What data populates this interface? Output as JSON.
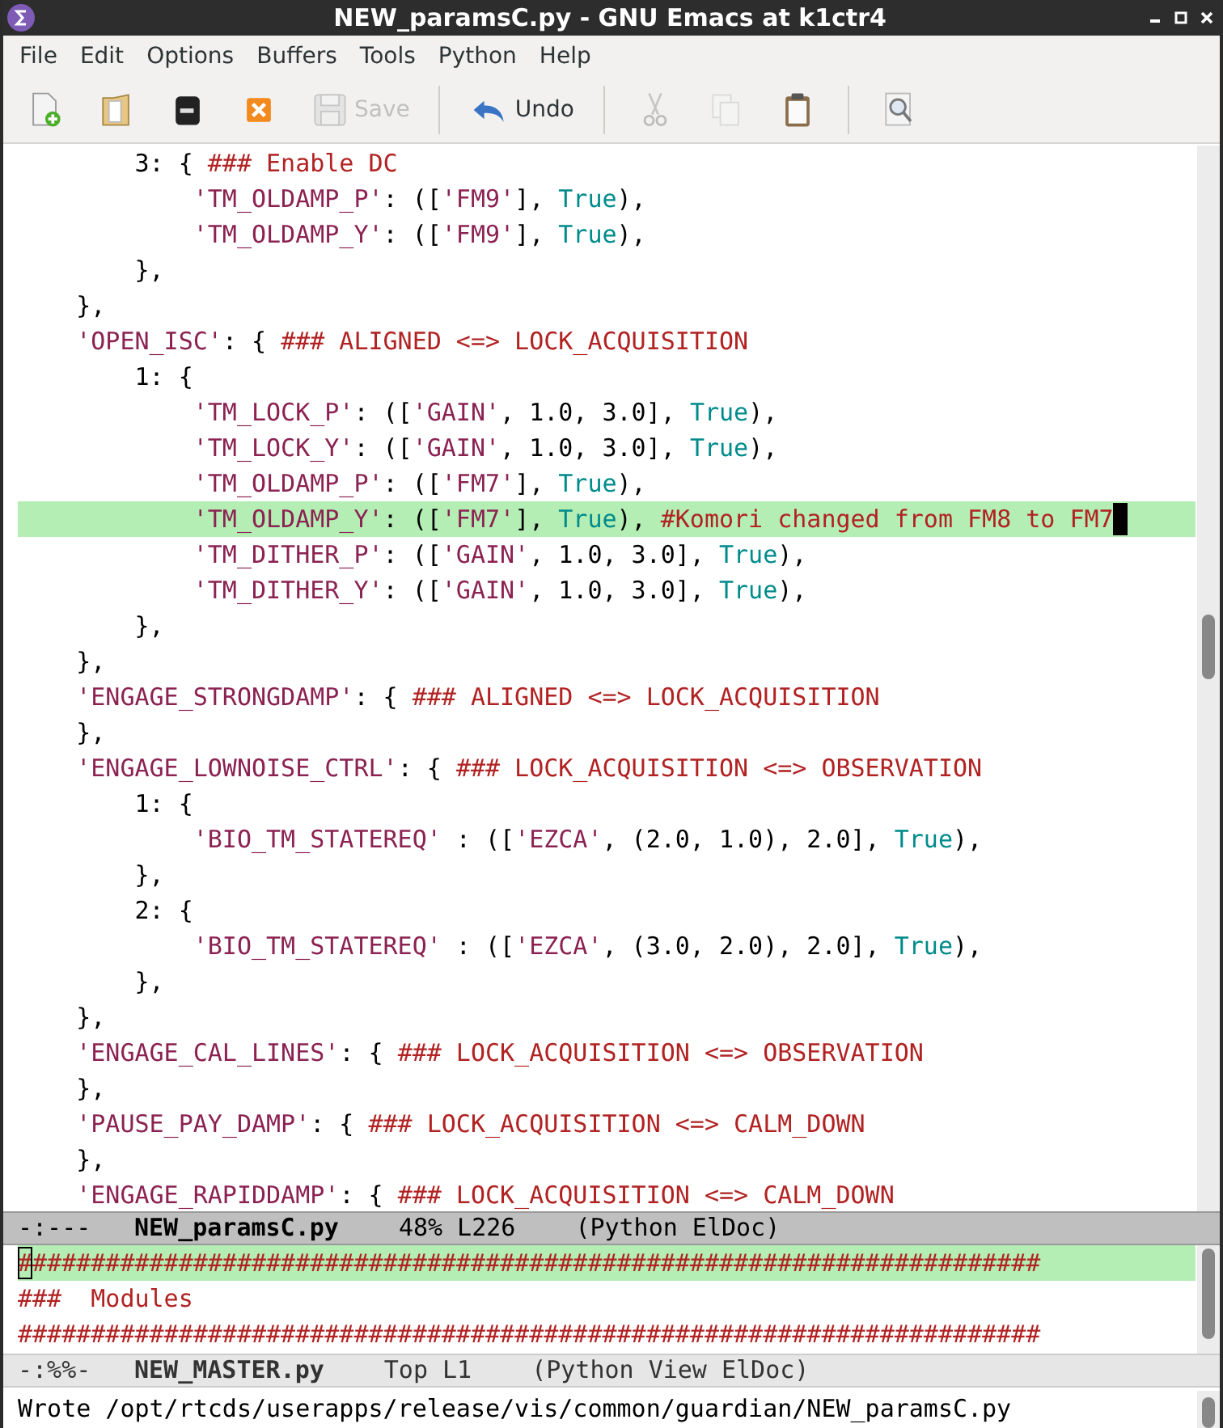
{
  "window": {
    "title": "NEW_paramsC.py - GNU Emacs at k1ctr4"
  },
  "menu_bar": [
    "File",
    "Edit",
    "Options",
    "Buffers",
    "Tools",
    "Python",
    "Help"
  ],
  "toolbar": [
    {
      "kind": "new-file",
      "disabled": false
    },
    {
      "kind": "open-folder",
      "disabled": false
    },
    {
      "kind": "close-buffer",
      "disabled": false
    },
    {
      "kind": "cancel",
      "disabled": false
    },
    {
      "kind": "save",
      "label": "Save",
      "disabled": true
    },
    {
      "kind": "separator"
    },
    {
      "kind": "undo",
      "label": "Undo",
      "disabled": false
    },
    {
      "kind": "separator"
    },
    {
      "kind": "cut",
      "disabled": true
    },
    {
      "kind": "copy",
      "disabled": true
    },
    {
      "kind": "paste",
      "disabled": false
    },
    {
      "kind": "separator"
    },
    {
      "kind": "search",
      "disabled": false
    }
  ],
  "panes": [
    {
      "active": true,
      "lines": [
        {
          "current": false,
          "tokens": [
            {
              "kind": "plain",
              "text": "        3: { "
            },
            {
              "kind": "comment",
              "text": "### Enable DC"
            }
          ]
        },
        {
          "current": false,
          "tokens": [
            {
              "kind": "string",
              "text": "            'TM_OLDAMP_P'"
            },
            {
              "kind": "plain",
              "text": ": (["
            },
            {
              "kind": "string",
              "text": "'FM9'"
            },
            {
              "kind": "plain",
              "text": "], "
            },
            {
              "kind": "builtin",
              "text": "True"
            },
            {
              "kind": "plain",
              "text": "),"
            }
          ]
        },
        {
          "current": false,
          "tokens": [
            {
              "kind": "string",
              "text": "            'TM_OLDAMP_Y'"
            },
            {
              "kind": "plain",
              "text": ": (["
            },
            {
              "kind": "string",
              "text": "'FM9'"
            },
            {
              "kind": "plain",
              "text": "], "
            },
            {
              "kind": "builtin",
              "text": "True"
            },
            {
              "kind": "plain",
              "text": "),"
            }
          ]
        },
        {
          "current": false,
          "tokens": [
            {
              "kind": "plain",
              "text": "        },"
            }
          ]
        },
        {
          "current": false,
          "tokens": [
            {
              "kind": "plain",
              "text": "    },"
            }
          ]
        },
        {
          "current": false,
          "tokens": [
            {
              "kind": "string",
              "text": "    'OPEN_ISC'"
            },
            {
              "kind": "plain",
              "text": ": { "
            },
            {
              "kind": "comment",
              "text": "### ALIGNED <=> LOCK_ACQUISITION"
            }
          ]
        },
        {
          "current": false,
          "tokens": [
            {
              "kind": "plain",
              "text": "        1: {"
            }
          ]
        },
        {
          "current": false,
          "tokens": [
            {
              "kind": "string",
              "text": "            'TM_LOCK_P'"
            },
            {
              "kind": "plain",
              "text": ": (["
            },
            {
              "kind": "string",
              "text": "'GAIN'"
            },
            {
              "kind": "plain",
              "text": ", 1.0, 3.0], "
            },
            {
              "kind": "builtin",
              "text": "True"
            },
            {
              "kind": "plain",
              "text": "),"
            }
          ]
        },
        {
          "current": false,
          "tokens": [
            {
              "kind": "string",
              "text": "            'TM_LOCK_Y'"
            },
            {
              "kind": "plain",
              "text": ": (["
            },
            {
              "kind": "string",
              "text": "'GAIN'"
            },
            {
              "kind": "plain",
              "text": ", 1.0, 3.0], "
            },
            {
              "kind": "builtin",
              "text": "True"
            },
            {
              "kind": "plain",
              "text": "),"
            }
          ]
        },
        {
          "current": false,
          "tokens": [
            {
              "kind": "string",
              "text": "            'TM_OLDAMP_P'"
            },
            {
              "kind": "plain",
              "text": ": (["
            },
            {
              "kind": "string",
              "text": "'FM7'"
            },
            {
              "kind": "plain",
              "text": "], "
            },
            {
              "kind": "builtin",
              "text": "True"
            },
            {
              "kind": "plain",
              "text": "),"
            }
          ]
        },
        {
          "current": true,
          "cursor_at_end": true,
          "tokens": [
            {
              "kind": "string",
              "text": "            'TM_OLDAMP_Y'"
            },
            {
              "kind": "plain",
              "text": ": (["
            },
            {
              "kind": "string",
              "text": "'FM7'"
            },
            {
              "kind": "plain",
              "text": "], "
            },
            {
              "kind": "builtin",
              "text": "True"
            },
            {
              "kind": "plain",
              "text": "), "
            },
            {
              "kind": "comment",
              "text": "#Komori changed from FM8 to FM7"
            }
          ]
        },
        {
          "current": false,
          "tokens": [
            {
              "kind": "string",
              "text": "            'TM_DITHER_P'"
            },
            {
              "kind": "plain",
              "text": ": (["
            },
            {
              "kind": "string",
              "text": "'GAIN'"
            },
            {
              "kind": "plain",
              "text": ", 1.0, 3.0], "
            },
            {
              "kind": "builtin",
              "text": "True"
            },
            {
              "kind": "plain",
              "text": "),"
            }
          ]
        },
        {
          "current": false,
          "tokens": [
            {
              "kind": "string",
              "text": "            'TM_DITHER_Y'"
            },
            {
              "kind": "plain",
              "text": ": (["
            },
            {
              "kind": "string",
              "text": "'GAIN'"
            },
            {
              "kind": "plain",
              "text": ", 1.0, 3.0], "
            },
            {
              "kind": "builtin",
              "text": "True"
            },
            {
              "kind": "plain",
              "text": "),"
            }
          ]
        },
        {
          "current": false,
          "tokens": [
            {
              "kind": "plain",
              "text": "        },"
            }
          ]
        },
        {
          "current": false,
          "tokens": [
            {
              "kind": "plain",
              "text": "    },"
            }
          ]
        },
        {
          "current": false,
          "tokens": [
            {
              "kind": "string",
              "text": "    'ENGAGE_STRONGDAMP'"
            },
            {
              "kind": "plain",
              "text": ": { "
            },
            {
              "kind": "comment",
              "text": "### ALIGNED <=> LOCK_ACQUISITION"
            }
          ]
        },
        {
          "current": false,
          "tokens": [
            {
              "kind": "plain",
              "text": "    },"
            }
          ]
        },
        {
          "current": false,
          "tokens": [
            {
              "kind": "string",
              "text": "    'ENGAGE_LOWNOISE_CTRL'"
            },
            {
              "kind": "plain",
              "text": ": { "
            },
            {
              "kind": "comment",
              "text": "### LOCK_ACQUISITION <=> OBSERVATION"
            }
          ]
        },
        {
          "current": false,
          "tokens": [
            {
              "kind": "plain",
              "text": "        1: {"
            }
          ]
        },
        {
          "current": false,
          "tokens": [
            {
              "kind": "string",
              "text": "            'BIO_TM_STATEREQ'"
            },
            {
              "kind": "plain",
              "text": " : (["
            },
            {
              "kind": "string",
              "text": "'EZCA'"
            },
            {
              "kind": "plain",
              "text": ", (2.0, 1.0), 2.0], "
            },
            {
              "kind": "builtin",
              "text": "True"
            },
            {
              "kind": "plain",
              "text": "),"
            }
          ]
        },
        {
          "current": false,
          "tokens": [
            {
              "kind": "plain",
              "text": "        },"
            }
          ]
        },
        {
          "current": false,
          "tokens": [
            {
              "kind": "plain",
              "text": "        2: {"
            }
          ]
        },
        {
          "current": false,
          "tokens": [
            {
              "kind": "string",
              "text": "            'BIO_TM_STATEREQ'"
            },
            {
              "kind": "plain",
              "text": " : (["
            },
            {
              "kind": "string",
              "text": "'EZCA'"
            },
            {
              "kind": "plain",
              "text": ", (3.0, 2.0), 2.0], "
            },
            {
              "kind": "builtin",
              "text": "True"
            },
            {
              "kind": "plain",
              "text": "),"
            }
          ]
        },
        {
          "current": false,
          "tokens": [
            {
              "kind": "plain",
              "text": "        },"
            }
          ]
        },
        {
          "current": false,
          "tokens": [
            {
              "kind": "plain",
              "text": "    },"
            }
          ]
        },
        {
          "current": false,
          "tokens": [
            {
              "kind": "string",
              "text": "    'ENGAGE_CAL_LINES'"
            },
            {
              "kind": "plain",
              "text": ": { "
            },
            {
              "kind": "comment",
              "text": "### LOCK_ACQUISITION <=> OBSERVATION"
            }
          ]
        },
        {
          "current": false,
          "tokens": [
            {
              "kind": "plain",
              "text": "    },"
            }
          ]
        },
        {
          "current": false,
          "tokens": [
            {
              "kind": "string",
              "text": "    'PAUSE_PAY_DAMP'"
            },
            {
              "kind": "plain",
              "text": ": { "
            },
            {
              "kind": "comment",
              "text": "### LOCK_ACQUISITION <=> CALM_DOWN"
            }
          ]
        },
        {
          "current": false,
          "tokens": [
            {
              "kind": "plain",
              "text": "    },"
            }
          ]
        },
        {
          "current": false,
          "tokens": [
            {
              "kind": "string",
              "text": "    'ENGAGE_RAPIDDAMP'"
            },
            {
              "kind": "plain",
              "text": ": { "
            },
            {
              "kind": "comment",
              "text": "### LOCK_ACQUISITION <=> CALM_DOWN"
            }
          ]
        }
      ],
      "mode_line": {
        "status": "-:---",
        "buffer": "NEW_paramsC.py",
        "position": "48% L226",
        "mode": "(Python ElDoc)"
      }
    },
    {
      "active": false,
      "lines": [
        {
          "current": true,
          "cursor_at_end": false,
          "tokens": [
            {
              "kind": "comment",
              "text": "######################################################################"
            }
          ]
        },
        {
          "current": false,
          "tokens": [
            {
              "kind": "comment",
              "text": "###  Modules"
            }
          ]
        },
        {
          "current": false,
          "tokens": [
            {
              "kind": "comment",
              "text": "######################################################################"
            }
          ]
        }
      ],
      "mode_line": {
        "status": "-:%%-",
        "buffer": "NEW_MASTER.py",
        "position": "Top L1",
        "mode": "(Python View ElDoc)"
      }
    }
  ],
  "echo_area": "Wrote /opt/rtcds/userapps/release/vis/common/guardian/NEW_paramsC.py"
}
